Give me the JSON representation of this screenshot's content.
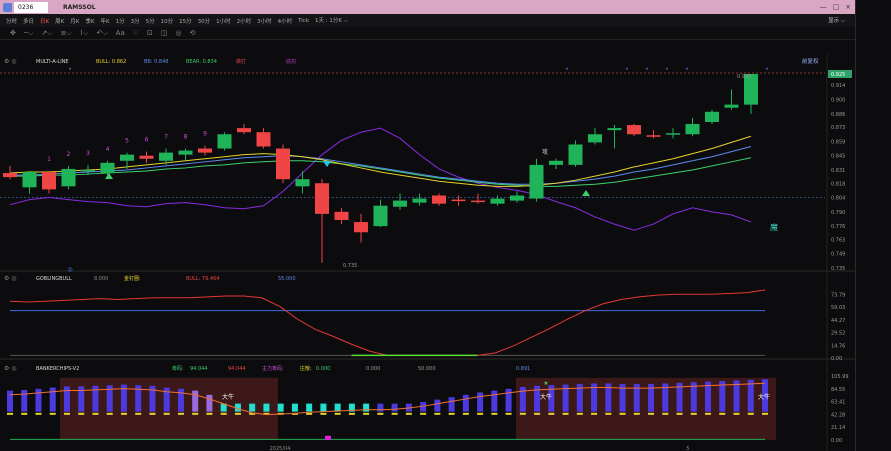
{
  "window": {
    "code": "0236",
    "name": "RAMSSOL",
    "controls": [
      "—",
      "□",
      "×"
    ]
  },
  "toolbar": {
    "items": [
      "分时",
      "多日",
      "日K",
      "周K",
      "月K",
      "季K",
      "年K",
      "1分",
      "3分",
      "5分",
      "10分",
      "15分",
      "30分",
      "1小时",
      "2小时",
      "3小时",
      "4小时",
      "Tick",
      "1天 : 1分K ⌵"
    ],
    "active_index": 2,
    "right": "显示 ⌵"
  },
  "drawbar": {
    "tools": [
      "✥",
      "╌⌵",
      "↗⌵",
      "≡⌵",
      "⌇⌵",
      "↶⌵",
      "Aa",
      "♡",
      "⊡",
      "◫",
      "◎",
      "⟲"
    ]
  },
  "main_pane": {
    "legend": {
      "name": "MULTI-A-LINE",
      "bull": "BULL: 0.862",
      "bb": "BB: 0.848",
      "bear": "BEAR: 0.834",
      "tags": [
        "做打",
        "底扣"
      ],
      "right_btn": "前复权",
      "colors": {
        "bull": "#e6d32e",
        "bb": "#5b8bf0",
        "bear": "#3dd06d"
      }
    },
    "y_labels": [
      "0.925",
      "0.914",
      "0.900",
      "0.886",
      "0.873",
      "0.859",
      "0.845",
      "0.831",
      "0.818",
      "0.804",
      "0.790",
      "0.776",
      "0.763",
      "0.749",
      "0.735"
    ],
    "current_price": "0.925",
    "high_label": "0.925",
    "low_label": "0.735",
    "seq_numbers": [
      "1",
      "2",
      "3",
      "4",
      "5",
      "6",
      "7",
      "8",
      "9"
    ],
    "sig_attack": "攻",
    "sig_demon": "魔"
  },
  "ind1": {
    "name": "GOBLINGBULL",
    "v1": "8.000",
    "v2_label": "金钉圈:",
    "bull": "BULL: 79.464",
    "blue": "55.000",
    "y_labels": [
      "73.79",
      "59.03",
      "44.27",
      "29.52",
      "14.76",
      "0.00"
    ]
  },
  "ind2": {
    "name": "BANKERCHIPS-V2",
    "main_label": "筹码:",
    "v1": "94.044",
    "v2": "94.044",
    "main_force_label": "主力筹码:",
    "main_force": "0.000",
    "retail_label": "庄散:",
    "retail": "0.000",
    "v5": "0.000",
    "v6": "50.000",
    "v7": "0.891",
    "y_labels": [
      "105.99",
      "84.55",
      "63.41",
      "42.28",
      "21.14",
      "0.00"
    ],
    "bull_text": "大牛"
  },
  "xaxis": {
    "labels": [
      "2025/04",
      "5"
    ]
  },
  "chart_data": {
    "type": "candlestick",
    "ylim": [
      0.735,
      0.925
    ],
    "candles": [
      {
        "o": 0.828,
        "h": 0.835,
        "l": 0.822,
        "c": 0.824
      },
      {
        "o": 0.814,
        "h": 0.83,
        "l": 0.808,
        "c": 0.829
      },
      {
        "o": 0.829,
        "h": 0.83,
        "l": 0.808,
        "c": 0.812
      },
      {
        "o": 0.815,
        "h": 0.835,
        "l": 0.812,
        "c": 0.832
      },
      {
        "o": 0.83,
        "h": 0.836,
        "l": 0.826,
        "c": 0.831
      },
      {
        "o": 0.828,
        "h": 0.84,
        "l": 0.826,
        "c": 0.838
      },
      {
        "o": 0.84,
        "h": 0.848,
        "l": 0.832,
        "c": 0.846
      },
      {
        "o": 0.845,
        "h": 0.849,
        "l": 0.838,
        "c": 0.842
      },
      {
        "o": 0.84,
        "h": 0.852,
        "l": 0.836,
        "c": 0.848
      },
      {
        "o": 0.846,
        "h": 0.852,
        "l": 0.84,
        "c": 0.85
      },
      {
        "o": 0.852,
        "h": 0.855,
        "l": 0.845,
        "c": 0.848
      },
      {
        "o": 0.852,
        "h": 0.868,
        "l": 0.85,
        "c": 0.866
      },
      {
        "o": 0.872,
        "h": 0.876,
        "l": 0.866,
        "c": 0.868
      },
      {
        "o": 0.868,
        "h": 0.872,
        "l": 0.852,
        "c": 0.854
      },
      {
        "o": 0.852,
        "h": 0.856,
        "l": 0.818,
        "c": 0.822
      },
      {
        "o": 0.815,
        "h": 0.83,
        "l": 0.808,
        "c": 0.822
      },
      {
        "o": 0.818,
        "h": 0.822,
        "l": 0.74,
        "c": 0.788
      },
      {
        "o": 0.79,
        "h": 0.794,
        "l": 0.778,
        "c": 0.782
      },
      {
        "o": 0.78,
        "h": 0.788,
        "l": 0.76,
        "c": 0.77
      },
      {
        "o": 0.776,
        "h": 0.802,
        "l": 0.775,
        "c": 0.796
      },
      {
        "o": 0.795,
        "h": 0.808,
        "l": 0.792,
        "c": 0.801
      },
      {
        "o": 0.799,
        "h": 0.808,
        "l": 0.796,
        "c": 0.803
      },
      {
        "o": 0.806,
        "h": 0.808,
        "l": 0.796,
        "c": 0.798
      },
      {
        "o": 0.802,
        "h": 0.806,
        "l": 0.796,
        "c": 0.801
      },
      {
        "o": 0.801,
        "h": 0.808,
        "l": 0.798,
        "c": 0.8
      },
      {
        "o": 0.798,
        "h": 0.806,
        "l": 0.796,
        "c": 0.803
      },
      {
        "o": 0.801,
        "h": 0.81,
        "l": 0.799,
        "c": 0.806
      },
      {
        "o": 0.803,
        "h": 0.842,
        "l": 0.8,
        "c": 0.836
      },
      {
        "o": 0.836,
        "h": 0.842,
        "l": 0.832,
        "c": 0.84
      },
      {
        "o": 0.836,
        "h": 0.86,
        "l": 0.834,
        "c": 0.856
      },
      {
        "o": 0.858,
        "h": 0.872,
        "l": 0.856,
        "c": 0.866
      },
      {
        "o": 0.87,
        "h": 0.875,
        "l": 0.852,
        "c": 0.872
      },
      {
        "o": 0.875,
        "h": 0.876,
        "l": 0.864,
        "c": 0.866
      },
      {
        "o": 0.865,
        "h": 0.87,
        "l": 0.862,
        "c": 0.864
      },
      {
        "o": 0.866,
        "h": 0.872,
        "l": 0.862,
        "c": 0.867
      },
      {
        "o": 0.866,
        "h": 0.882,
        "l": 0.864,
        "c": 0.876
      },
      {
        "o": 0.878,
        "h": 0.89,
        "l": 0.876,
        "c": 0.888
      },
      {
        "o": 0.892,
        "h": 0.91,
        "l": 0.89,
        "c": 0.895
      },
      {
        "o": 0.895,
        "h": 0.925,
        "l": 0.886,
        "c": 0.925
      }
    ],
    "ma_yellow": [
      0.828,
      0.829,
      0.829,
      0.83,
      0.831,
      0.832,
      0.834,
      0.836,
      0.838,
      0.84,
      0.842,
      0.844,
      0.846,
      0.847,
      0.846,
      0.844,
      0.841,
      0.837,
      0.833,
      0.829,
      0.826,
      0.823,
      0.82,
      0.818,
      0.816,
      0.815,
      0.815,
      0.816,
      0.818,
      0.821,
      0.825,
      0.829,
      0.834,
      0.838,
      0.842,
      0.847,
      0.852,
      0.858,
      0.864
    ],
    "ma_blue": [
      0.826,
      0.826,
      0.827,
      0.828,
      0.829,
      0.83,
      0.831,
      0.833,
      0.835,
      0.837,
      0.839,
      0.841,
      0.843,
      0.844,
      0.845,
      0.844,
      0.842,
      0.839,
      0.836,
      0.833,
      0.83,
      0.827,
      0.824,
      0.822,
      0.82,
      0.818,
      0.817,
      0.817,
      0.818,
      0.82,
      0.822,
      0.825,
      0.829,
      0.832,
      0.836,
      0.84,
      0.844,
      0.849,
      0.854
    ],
    "ma_green": [
      0.825,
      0.825,
      0.826,
      0.826,
      0.827,
      0.828,
      0.829,
      0.83,
      0.832,
      0.833,
      0.835,
      0.836,
      0.838,
      0.839,
      0.84,
      0.84,
      0.839,
      0.837,
      0.835,
      0.832,
      0.829,
      0.826,
      0.823,
      0.821,
      0.819,
      0.817,
      0.816,
      0.815,
      0.815,
      0.816,
      0.817,
      0.819,
      0.822,
      0.825,
      0.828,
      0.831,
      0.835,
      0.839,
      0.843
    ],
    "ma_purple": [
      0.797,
      0.802,
      0.804,
      0.802,
      0.8,
      0.799,
      0.796,
      0.795,
      0.798,
      0.799,
      0.797,
      0.794,
      0.793,
      0.796,
      0.81,
      0.828,
      0.846,
      0.86,
      0.868,
      0.872,
      0.862,
      0.846,
      0.832,
      0.824,
      0.818,
      0.814,
      0.811,
      0.807,
      0.8,
      0.794,
      0.785,
      0.778,
      0.772,
      0.778,
      0.788,
      0.794,
      0.79,
      0.787,
      0.78
    ],
    "ind1_red": [
      66,
      65,
      66,
      67,
      68,
      69,
      68,
      69,
      70,
      70,
      70,
      71,
      72,
      72,
      70,
      60,
      45,
      33,
      25,
      16,
      8,
      3,
      3,
      3,
      3,
      3,
      3,
      6,
      14,
      24,
      34,
      45,
      55,
      63,
      68,
      71,
      73,
      74,
      74,
      74,
      75,
      76,
      79
    ],
    "ind1_blue": [
      55,
      55
    ],
    "ind2_main": [
      75,
      76,
      78,
      80,
      82,
      82,
      83,
      84,
      85,
      84,
      83,
      80,
      78,
      75,
      68,
      60,
      52,
      45,
      42,
      43,
      44,
      46,
      47,
      48,
      49,
      50,
      50,
      51,
      53,
      56,
      60,
      64,
      68,
      72,
      75,
      78,
      81,
      83,
      84,
      85,
      86,
      87,
      87,
      86,
      86,
      86,
      87,
      88,
      89,
      90,
      91,
      92,
      93,
      94
    ],
    "ind2_bars": [
      60,
      62,
      64,
      66,
      68,
      70,
      72,
      74,
      76,
      78,
      79,
      79,
      80,
      80,
      80,
      80,
      80,
      80,
      80,
      80,
      80,
      80,
      80,
      80,
      80,
      80,
      80,
      80,
      80,
      80,
      80,
      80,
      80,
      80,
      80,
      80,
      80,
      80,
      80,
      80,
      80,
      80,
      80,
      80,
      80,
      80,
      80,
      80,
      80,
      80,
      80,
      80,
      80,
      80
    ]
  }
}
